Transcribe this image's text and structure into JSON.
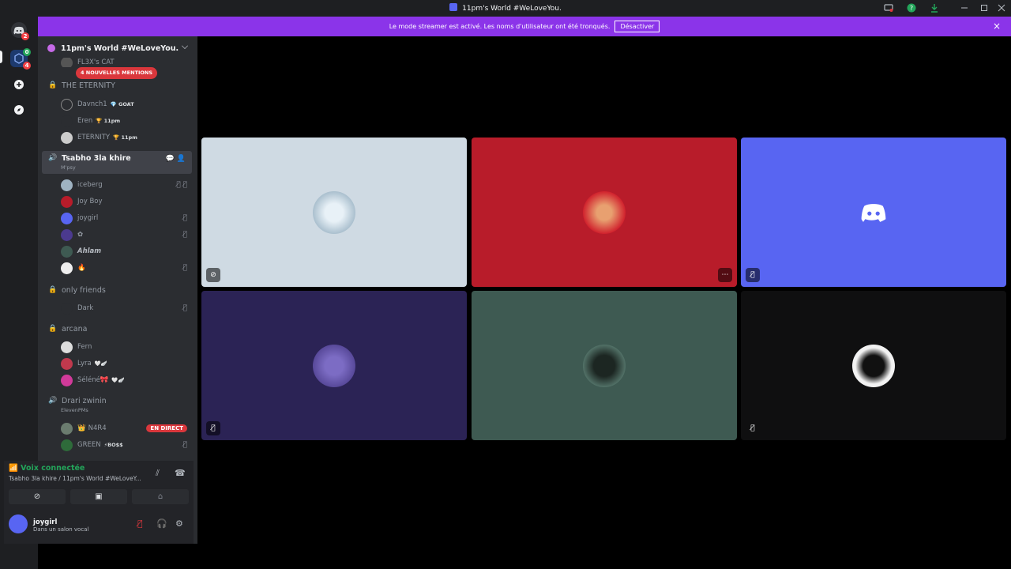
{
  "window": {
    "title": "11pm's World #WeLoveYou."
  },
  "guilds": {
    "dm_badge": "2",
    "server_badge_top": "0",
    "server_badge_bottom": "4"
  },
  "banner": {
    "text": "Le mode streamer est activé. Les noms d'utilisateur ont été tronqués.",
    "button": "Désactiver",
    "close": "×"
  },
  "server": {
    "name": "11pm's World #WeLoveYou."
  },
  "mentions": {
    "label": "4 NOUVELLES MENTIONS"
  },
  "clipped_user": "FL3X's CAT",
  "channels": {
    "eternity": "THE ETERNITY",
    "active": {
      "name": "Tsabho 3la khire",
      "sub": "M'psy"
    },
    "friends": "only friends",
    "arcana": "arcana",
    "drari": {
      "name": "Drari zwinin",
      "sub": "ElevenPMs"
    }
  },
  "users": {
    "davnch": {
      "name": "Davnch1",
      "tag": "💎 GOAT"
    },
    "eren": {
      "name": "Eren",
      "tag": "🏆 11pm"
    },
    "eternity": {
      "name": "ETERNITY",
      "tag": "🏆 11pm"
    },
    "iceberg": {
      "name": "iceberg"
    },
    "joyboy": {
      "name": "Joy Boy"
    },
    "joygirl": {
      "name": "joygirl"
    },
    "flower": {
      "name": "✿"
    },
    "ahlam": {
      "name": "Ahlam"
    },
    "flame": {
      "name": "🔥"
    },
    "dark": {
      "name": "Dark"
    },
    "fern": {
      "name": "Fern"
    },
    "lyra": {
      "name": "Lyra",
      "tag": "🤍🪽"
    },
    "selene": {
      "name": "Séléné🎀",
      "tag": "🤍🪽"
    },
    "n4r4": {
      "name": "N4R4",
      "live": "EN DIRECT",
      "prefix": "👑"
    },
    "green": {
      "name": "GREEN",
      "tag": "⚡BO$$"
    }
  },
  "voice_panel": {
    "status": "Voix connectée",
    "location": "Tsabho 3la khire / 11pm's World #WeLoveY..."
  },
  "account": {
    "name": "joygirl",
    "status": "Dans un salon vocal"
  },
  "colors": {
    "accent": "#5865f2",
    "banner": "#8b34e9",
    "danger": "#da373c",
    "online": "#23a55a"
  }
}
